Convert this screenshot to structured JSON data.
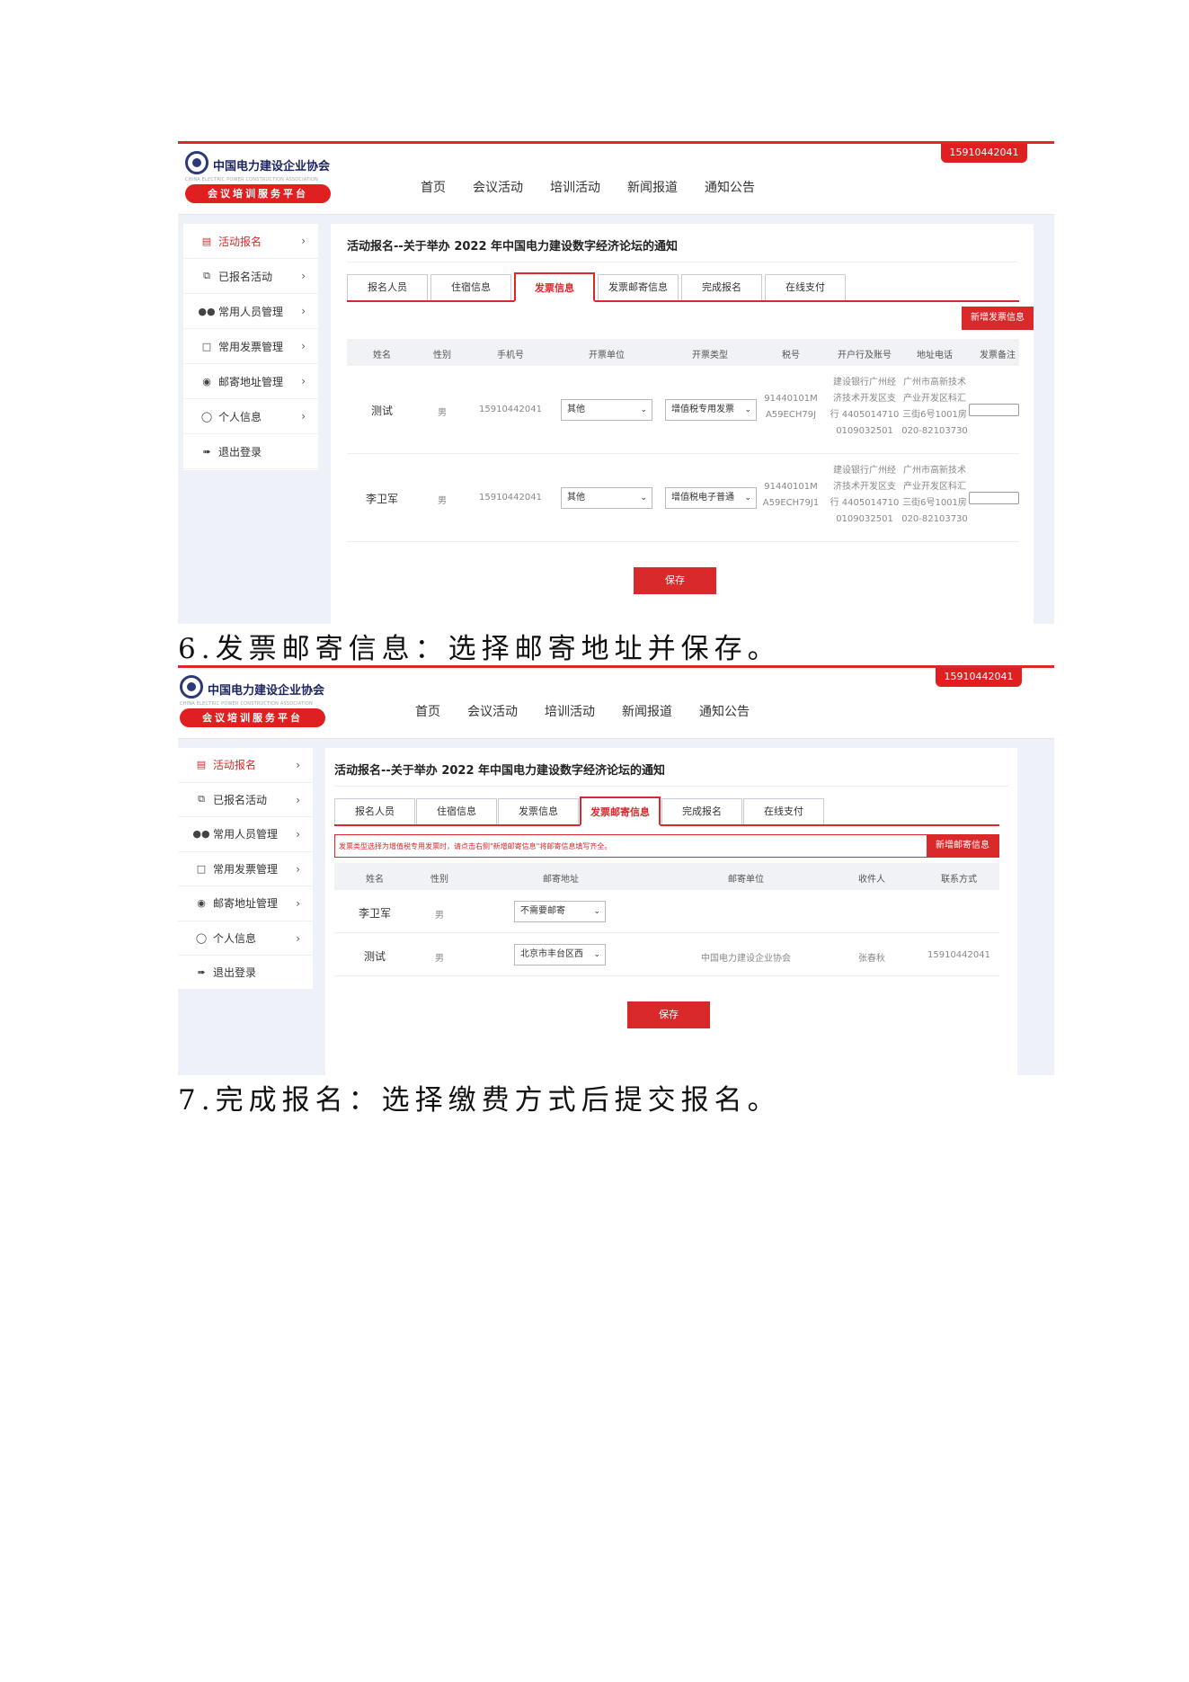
{
  "header": {
    "org_name": "中国电力建设企业协会",
    "org_english": "CHINA ELECTRIC POWER CONSTRUCTION ASSOCIATION",
    "platform": "会议培训服务平台",
    "phone": "15910442041",
    "nav": [
      "首页",
      "会议活动",
      "培训活动",
      "新闻报道",
      "通知公告"
    ]
  },
  "sidebar": {
    "items": [
      {
        "label": "活动报名",
        "icon": "document-icon"
      },
      {
        "label": "已报名活动",
        "icon": "copy-icon"
      },
      {
        "label": "常用人员管理",
        "icon": "users-icon"
      },
      {
        "label": "常用发票管理",
        "icon": "file-icon"
      },
      {
        "label": "邮寄地址管理",
        "icon": "location-pin-icon"
      },
      {
        "label": "个人信息",
        "icon": "user-icon"
      },
      {
        "label": "退出登录",
        "icon": "logout-icon"
      }
    ]
  },
  "page_title": "活动报名--关于举办 2022 年中国电力建设数字经济论坛的通知",
  "tabs": [
    "报名人员",
    "住宿信息",
    "发票信息",
    "发票邮寄信息",
    "完成报名",
    "在线支付"
  ],
  "invoice_step": {
    "active_tab": "发票信息",
    "add_button": "新增发票信息",
    "columns": [
      "姓名",
      "性别",
      "手机号",
      "开票单位",
      "开票类型",
      "税号",
      "开户行及账号",
      "地址电话",
      "发票备注"
    ],
    "rows": [
      {
        "name": "测试",
        "gender": "男",
        "phone": "15910442041",
        "unit": "其他",
        "type": "增值税专用发票",
        "tax_line1": "91440101M",
        "tax_line2": "A59ECH79J",
        "bank_line1": "建设银行广州经",
        "bank_line2": "济技术开发区支",
        "bank_line3": "行 4405014710",
        "bank_line4": "0109032501",
        "addr_line1": "广州市高新技术",
        "addr_line2": "产业开发区科汇",
        "addr_line3": "三街6号1001房",
        "addr_line4": "020-82103730"
      },
      {
        "name": "李卫军",
        "gender": "男",
        "phone": "15910442041",
        "unit": "其他",
        "type": "增值税电子普通",
        "tax_line1": "91440101M",
        "tax_line2": "A59ECH79J1",
        "bank_line1": "建设银行广州经",
        "bank_line2": "济技术开发区支",
        "bank_line3": "行 4405014710",
        "bank_line4": "0109032501",
        "addr_line1": "广州市高新技术",
        "addr_line2": "产业开发区科汇",
        "addr_line3": "三街6号1001房",
        "addr_line4": "020-82103730"
      }
    ],
    "save_label": "保存"
  },
  "caption_6": "6.发票邮寄信息：选择邮寄地址并保存。",
  "mail_step": {
    "active_tab": "发票邮寄信息",
    "notice": "发票类型选择为增值税专用发票时，请点击右侧\"新增邮寄信息\"将邮寄信息填写齐全。",
    "add_button": "新增邮寄信息",
    "columns": [
      "姓名",
      "性别",
      "邮寄地址",
      "邮寄单位",
      "收件人",
      "联系方式"
    ],
    "rows": [
      {
        "name": "李卫军",
        "gender": "男",
        "address": "不需要邮寄",
        "unit": "",
        "recipient": "",
        "contact": ""
      },
      {
        "name": "测试",
        "gender": "男",
        "address": "北京市丰台区西",
        "unit": "中国电力建设企业协会",
        "recipient": "张春秋",
        "contact": "15910442041"
      }
    ],
    "save_label": "保存"
  },
  "caption_7": "7.完成报名：选择缴费方式后提交报名。",
  "colors": {
    "accent": "#d9292b",
    "brand_navy": "#1b2460",
    "panel_bg": "#eef1f8"
  }
}
